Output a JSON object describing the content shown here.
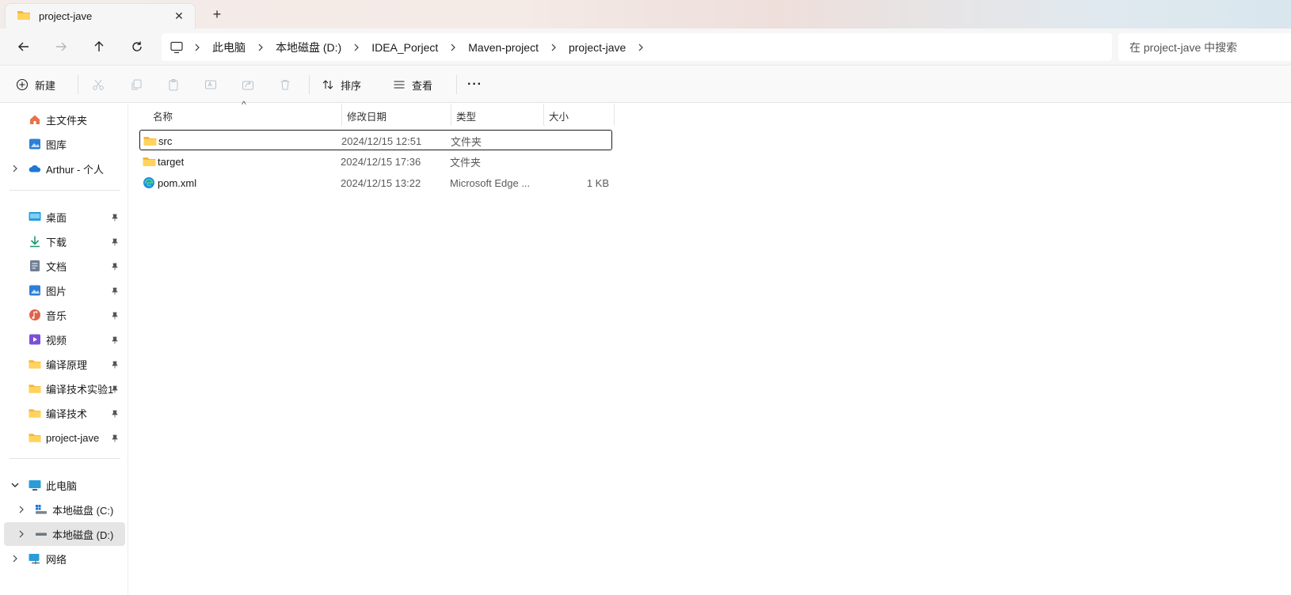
{
  "tab": {
    "title": "project-jave",
    "close": "✕",
    "new": "+"
  },
  "breadcrumb": [
    "此电脑",
    "本地磁盘 (D:)",
    "IDEA_Porject",
    "Maven-project",
    "project-jave"
  ],
  "search": {
    "placeholder": "在 project-jave 中搜索"
  },
  "toolbar": {
    "new_label": "新建",
    "sort_label": "排序",
    "view_label": "查看",
    "more_label": "···"
  },
  "sidebar": {
    "quick": [
      {
        "label": "主文件夹",
        "icon": "home-icon"
      },
      {
        "label": "图库",
        "icon": "gallery-icon"
      },
      {
        "label": "Arthur - 个人",
        "icon": "onedrive-cloud-icon"
      }
    ],
    "pinned": [
      {
        "label": "桌面",
        "icon": "desktop-icon"
      },
      {
        "label": "下载",
        "icon": "download-icon"
      },
      {
        "label": "文档",
        "icon": "document-icon"
      },
      {
        "label": "图片",
        "icon": "pictures-icon"
      },
      {
        "label": "音乐",
        "icon": "music-icon"
      },
      {
        "label": "视频",
        "icon": "video-icon"
      },
      {
        "label": "编译原理",
        "icon": "folder-icon"
      },
      {
        "label": "编译技术实验1-",
        "icon": "folder-icon"
      },
      {
        "label": "编译技术",
        "icon": "folder-icon"
      },
      {
        "label": "project-jave",
        "icon": "folder-icon"
      }
    ],
    "pc": {
      "label": "此电脑"
    },
    "drives": [
      {
        "label": "本地磁盘 (C:)",
        "icon": "windows-drive-icon"
      },
      {
        "label": "本地磁盘 (D:)",
        "icon": "drive-icon",
        "selected": true
      }
    ],
    "network": {
      "label": "网络"
    }
  },
  "columns": {
    "name": "名称",
    "modified": "修改日期",
    "type": "类型",
    "size": "大小",
    "sort_indicator": "^"
  },
  "files": [
    {
      "name": "src",
      "modified": "2024/12/15 12:51",
      "type": "文件夹",
      "size": "",
      "icon": "folder-icon"
    },
    {
      "name": "target",
      "modified": "2024/12/15 17:36",
      "type": "文件夹",
      "size": "",
      "icon": "folder-icon"
    },
    {
      "name": "pom.xml",
      "modified": "2024/12/15 13:22",
      "type": "Microsoft Edge ...",
      "size": "1 KB",
      "icon": "edge-icon"
    }
  ]
}
